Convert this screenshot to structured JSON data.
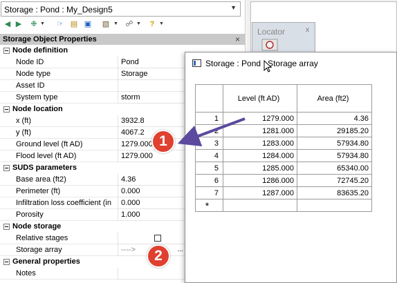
{
  "object_selector": {
    "value": "Storage : Pond : My_Design5"
  },
  "panel": {
    "title": "Storage Object Properties"
  },
  "sections": {
    "node_definition": "Node definition",
    "node_location": "Node location",
    "suds_parameters": "SUDS parameters",
    "node_storage": "Node storage",
    "general_properties": "General properties"
  },
  "props": {
    "node_id": {
      "label": "Node ID",
      "value": "Pond"
    },
    "node_type": {
      "label": "Node type",
      "value": "Storage"
    },
    "asset_id": {
      "label": "Asset ID",
      "value": ""
    },
    "system_type": {
      "label": "System type",
      "value": "storm"
    },
    "x": {
      "label": "x (ft)",
      "value": "3932.8"
    },
    "y": {
      "label": "y (ft)",
      "value": "4067.2"
    },
    "ground_level": {
      "label": "Ground level (ft AD)",
      "value": "1279.000"
    },
    "flood_level": {
      "label": "Flood level (ft AD)",
      "value": "1279.000"
    },
    "base_area": {
      "label": "Base area (ft2)",
      "value": "4.36"
    },
    "perimeter": {
      "label": "Perimeter (ft)",
      "value": "0.000"
    },
    "infiltration": {
      "label": "Infiltration loss coefficient (in",
      "value": "0.000"
    },
    "porosity": {
      "label": "Porosity",
      "value": "1.000"
    },
    "relative_stages": {
      "label": "Relative stages",
      "value": ""
    },
    "storage_array": {
      "label": "Storage array",
      "value": "---->",
      "button": "..."
    },
    "notes": {
      "label": "Notes",
      "value": ""
    }
  },
  "locator": {
    "title": "Locator",
    "close": "x"
  },
  "array_window": {
    "title": "Storage : Pond : Storage array",
    "columns": [
      "Level (ft AD)",
      "Area (ft2)"
    ],
    "rows": [
      {
        "n": "1",
        "level": "1279.000",
        "area": "4.36"
      },
      {
        "n": "2",
        "level": "1281.000",
        "area": "29185.20"
      },
      {
        "n": "3",
        "level": "1283.000",
        "area": "57934.80"
      },
      {
        "n": "4",
        "level": "1284.000",
        "area": "57934.80"
      },
      {
        "n": "5",
        "level": "1285.000",
        "area": "65340.00"
      },
      {
        "n": "6",
        "level": "1286.000",
        "area": "72745.20"
      },
      {
        "n": "7",
        "level": "1287.000",
        "area": "83635.20"
      }
    ],
    "new_row_marker": "*"
  },
  "callouts": {
    "one": "1",
    "two": "2"
  },
  "colors": {
    "callout": "#e0402f",
    "arrow": "#5b4a9e",
    "header_bar": "#c9c9c9"
  }
}
